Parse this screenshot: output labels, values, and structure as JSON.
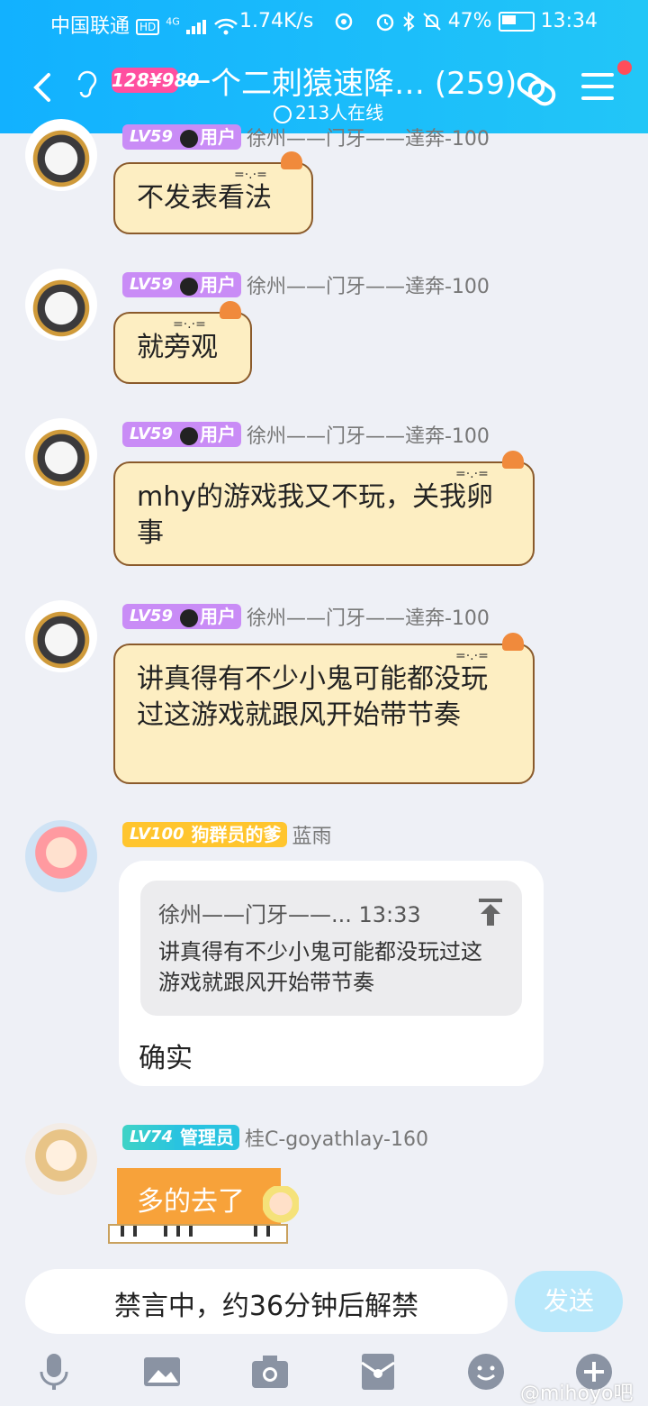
{
  "status_bar": {
    "carrier": "中国联通",
    "hd_badge": "HD",
    "signal_type": "4G",
    "net_speed": "1.74K/s",
    "battery": "47%",
    "time": "13:34"
  },
  "header": {
    "badge": "128¥980",
    "title": "一个二刺猿速降…",
    "member_count": "(259)",
    "online": "213人在线"
  },
  "messages": [
    {
      "level": "LV59",
      "role": "用户",
      "name": "徐州——门牙——達奔-100",
      "text": "不发表看法"
    },
    {
      "level": "LV59",
      "role": "用户",
      "name": "徐州——门牙——達奔-100",
      "text": "就旁观"
    },
    {
      "level": "LV59",
      "role": "用户",
      "name": "徐州——门牙——達奔-100",
      "text": "mhy的游戏我又不玩，关我卵事"
    },
    {
      "level": "LV59",
      "role": "用户",
      "name": "徐州——门牙——達奔-100",
      "text": "讲真得有不少小鬼可能都没玩过这游戏就跟风开始带节奏"
    },
    {
      "level": "LV100",
      "role": "狗群员的爹",
      "name": "蓝雨",
      "quote_header": "徐州——门牙——... 13:33",
      "quote_text": "讲真得有不少小鬼可能都没玩过这游戏就跟风开始带节奏",
      "text": "确实"
    },
    {
      "level": "LV74",
      "role": "管理员",
      "name": "桂C-goyathlay-160",
      "text": "多的去了"
    }
  ],
  "input": {
    "muted_text": "禁言中，约36分钟后解禁",
    "send_label": "发送"
  },
  "toolbar_icons": [
    "microphone-icon",
    "image-icon",
    "camera-icon",
    "red-packet-icon",
    "emoji-icon",
    "plus-icon"
  ],
  "watermark": "@mihoyo吧",
  "colors": {
    "header_start": "#12b1ff",
    "header_end": "#22c6f7",
    "bubble_fill": "#fdeec2",
    "level_purple": "#c98cf6",
    "level_gold": "#ffc52e",
    "admin_bubble": "#f7a23a",
    "send_button": "#b9e8fb"
  }
}
